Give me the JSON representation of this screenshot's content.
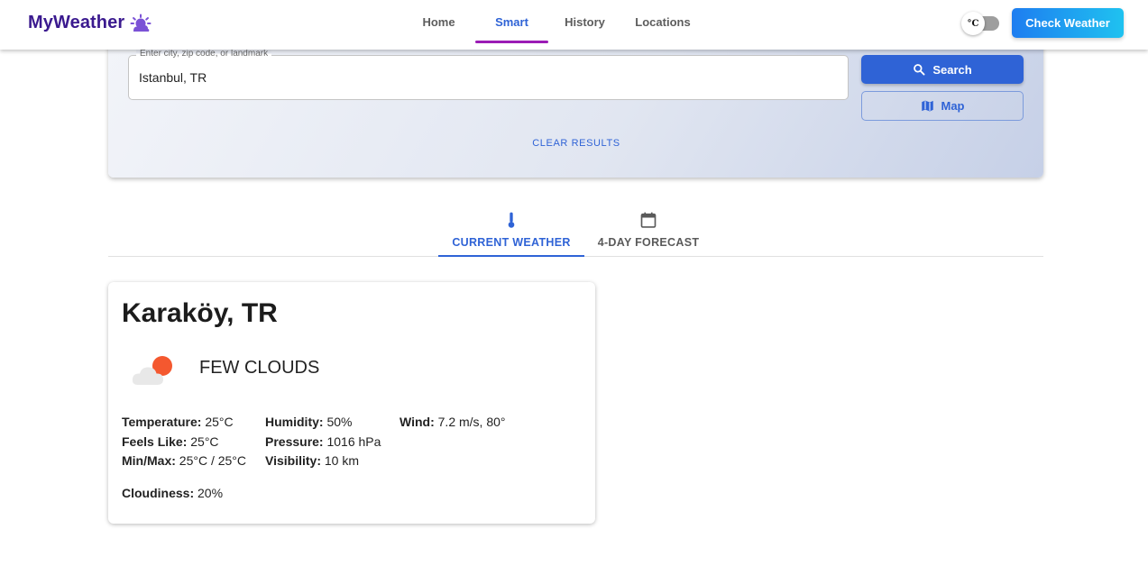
{
  "brand": {
    "title": "MyWeather",
    "icon": "weather-logo-icon",
    "color": "#3b1a8f"
  },
  "nav": {
    "items": [
      {
        "label": "Home",
        "active": false
      },
      {
        "label": "Smart",
        "active": true
      },
      {
        "label": "History",
        "active": false
      },
      {
        "label": "Locations",
        "active": false
      }
    ],
    "active_underline_color": "#9b1cb5"
  },
  "unit_toggle": {
    "label": "°C",
    "checked": false
  },
  "header_button": {
    "label": "Check Weather"
  },
  "search": {
    "placeholder": "Enter city, zip code, or landmark",
    "value": "Istanbul, TR",
    "search_label": "Search",
    "map_label": "Map",
    "clear_label": "CLEAR RESULTS"
  },
  "tabs": [
    {
      "label": "CURRENT WEATHER",
      "icon": "thermometer-icon",
      "active": true
    },
    {
      "label": "4-DAY FORECAST",
      "icon": "calendar-icon",
      "active": false
    }
  ],
  "current": {
    "location": "Karaköy, TR",
    "condition": "FEW CLOUDS",
    "condition_icon": "few-clouds-icon",
    "stats": {
      "temperature": {
        "label": "Temperature:",
        "value": "25°C"
      },
      "feels_like": {
        "label": "Feels Like:",
        "value": "25°C"
      },
      "min_max": {
        "label": "Min/Max:",
        "value": "25°C / 25°C"
      },
      "humidity": {
        "label": "Humidity:",
        "value": "50%"
      },
      "pressure": {
        "label": "Pressure:",
        "value": "1016 hPa"
      },
      "visibility": {
        "label": "Visibility:",
        "value": "10 km"
      },
      "wind": {
        "label": "Wind:",
        "value": "7.2 m/s, 80°"
      },
      "cloudiness": {
        "label": "Cloudiness:",
        "value": "20%"
      }
    }
  },
  "colors": {
    "accent": "#2f63d6",
    "check_gradient_start": "#1e7df0",
    "check_gradient_end": "#1fc2f0",
    "sun": "#f4582f"
  }
}
